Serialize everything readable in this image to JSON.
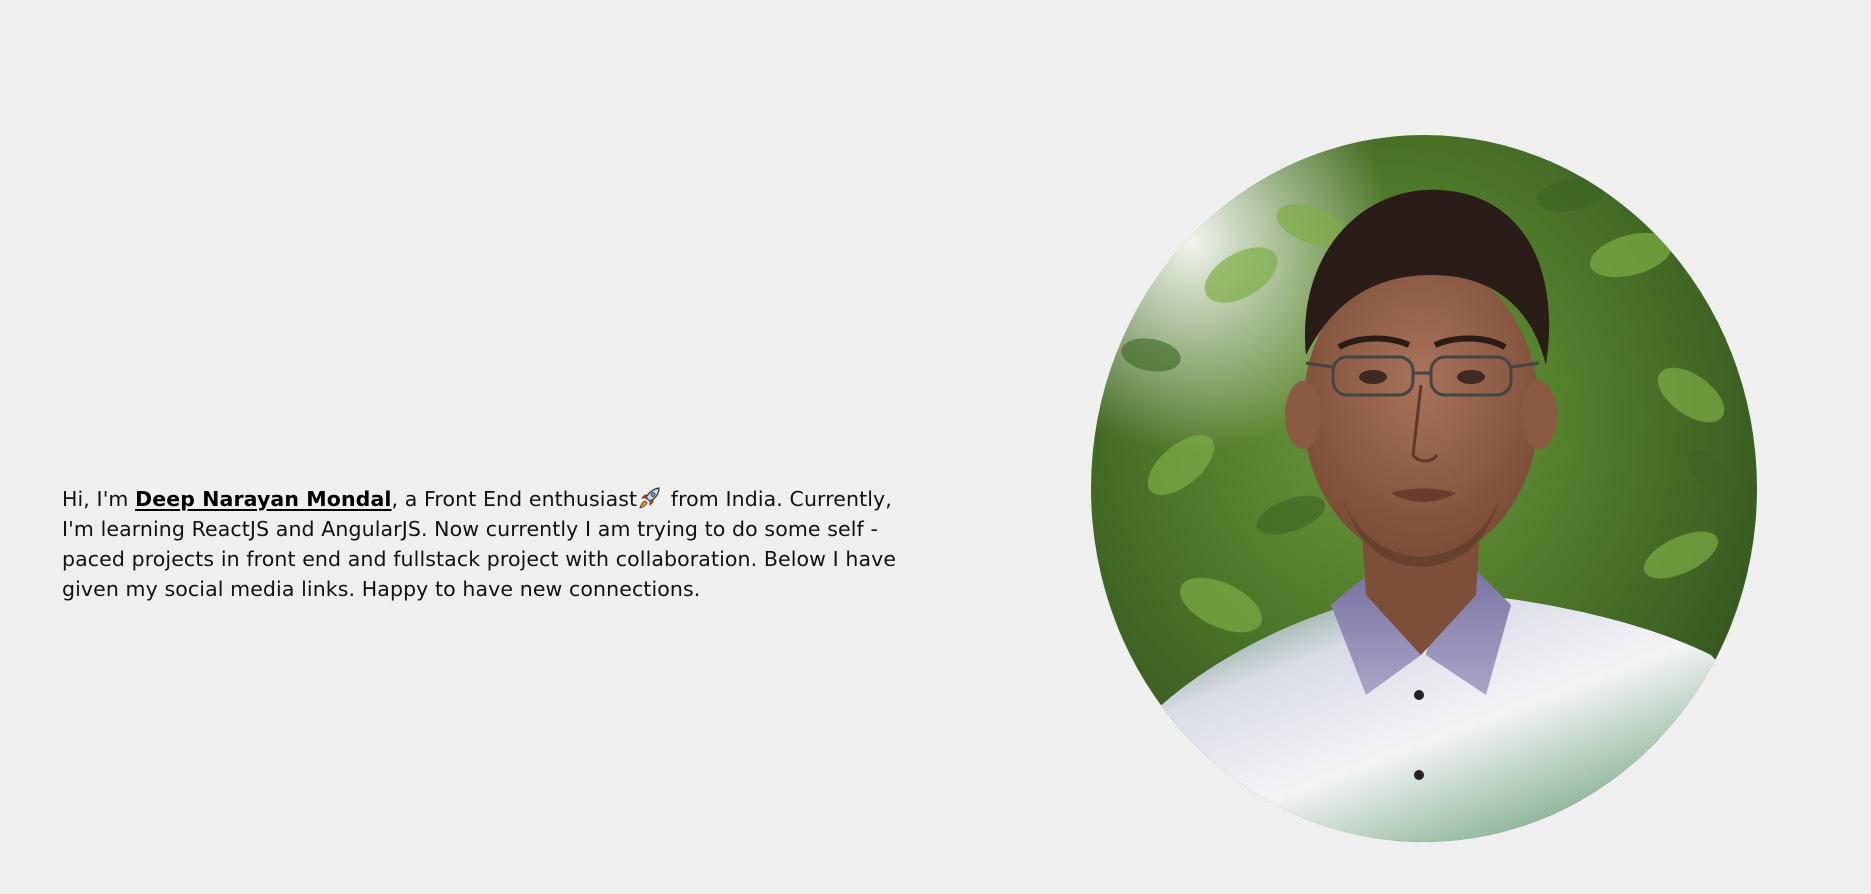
{
  "intro": {
    "greeting": "Hi, I'm ",
    "name": "Deep Narayan Mondal",
    "after_name": ", a Front End enthusiast",
    "rocket_icon": "rocket-icon",
    "rest": " from India. Currently, I'm learning ReactJS and AngularJS. Now currently I am trying to do some self - paced projects in front end and fullstack project with collaboration. Below I have given my social media links. Happy to have new connections."
  },
  "profile_photo": {
    "icon": "profile-photo"
  },
  "colors": {
    "background": "#efefef",
    "text": "#111111"
  }
}
